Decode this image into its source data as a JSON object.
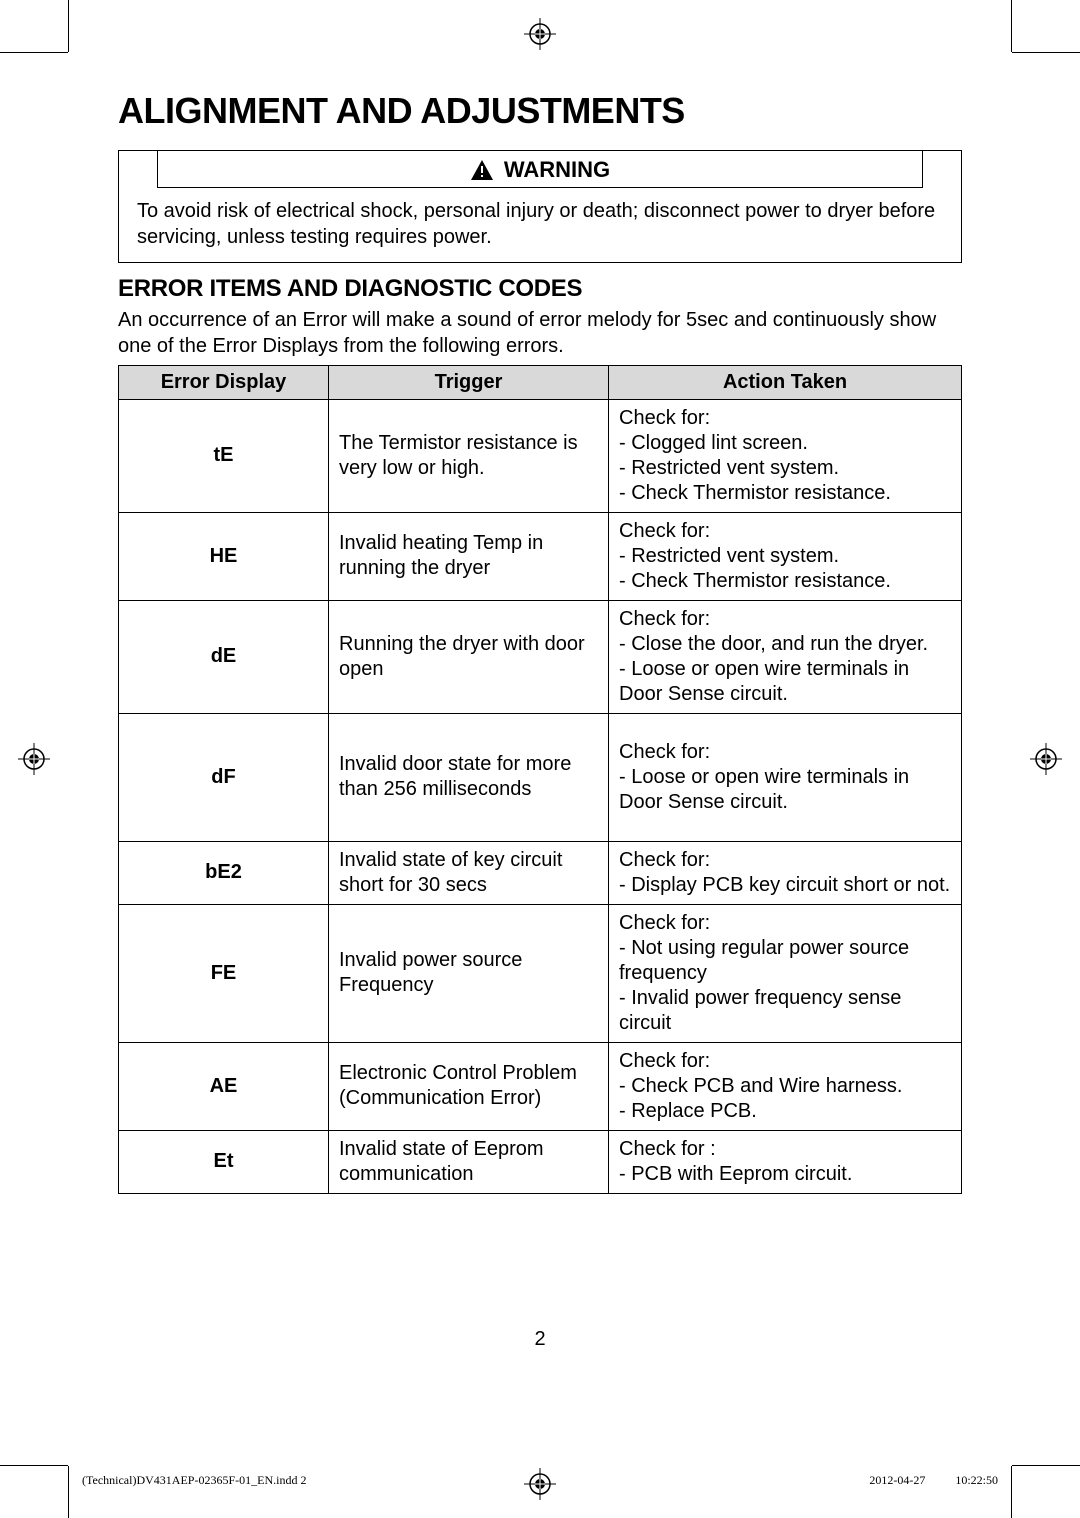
{
  "heading": "ALIGNMENT AND ADJUSTMENTS",
  "warning": {
    "label": "WARNING",
    "text": "To avoid risk of electrical shock, personal injury or death; disconnect power to dryer before servicing, unless testing requires power."
  },
  "section_heading": "ERROR ITEMS AND DIAGNOSTIC CODES",
  "intro": "An occurrence of an Error will make a sound of error melody for 5sec and continuously show one of the Error Displays from the following errors.",
  "table": {
    "headers": [
      "Error Display",
      "Trigger",
      "Action Taken"
    ],
    "rows": [
      {
        "code": "tE",
        "trigger": "The Termistor resistance is very low or high.",
        "action": "Check for:\n- Clogged lint screen.\n- Restricted vent system.\n- Check Thermistor resistance."
      },
      {
        "code": "HE",
        "trigger": "Invalid heating Temp in running the dryer",
        "action": "Check for:\n- Restricted vent system.\n- Check Thermistor resistance."
      },
      {
        "code": "dE",
        "trigger": "Running the dryer with door open",
        "action": "Check for:\n- Close the door, and run the dryer.\n- Loose or open wire terminals in Door Sense circuit."
      },
      {
        "code": "dF",
        "trigger": "Invalid door state for more than 256 milliseconds",
        "action": "Check for:\n- Loose or open wire terminals in Door Sense circuit."
      },
      {
        "code": "bE2",
        "trigger": "Invalid state of key circuit short for 30 secs",
        "action": "Check for:\n- Display PCB key circuit short or not."
      },
      {
        "code": "FE",
        "trigger": "Invalid power source Frequency",
        "action": "Check for:\n- Not using regular power source frequency\n- Invalid power frequency sense circuit"
      },
      {
        "code": "AE",
        "trigger": "Electronic Control Problem (Communication Error)",
        "action": "Check for:\n- Check PCB and Wire harness.\n- Replace PCB."
      },
      {
        "code": "Et",
        "trigger": "Invalid state of Eeprom communication",
        "action": "Check for :\n- PCB with Eeprom circuit."
      }
    ]
  },
  "page_number": "2",
  "footer": {
    "left": "(Technical)DV431AEP-02365F-01_EN.indd   2",
    "right": "2012-04-27   　　 10:22:50"
  }
}
